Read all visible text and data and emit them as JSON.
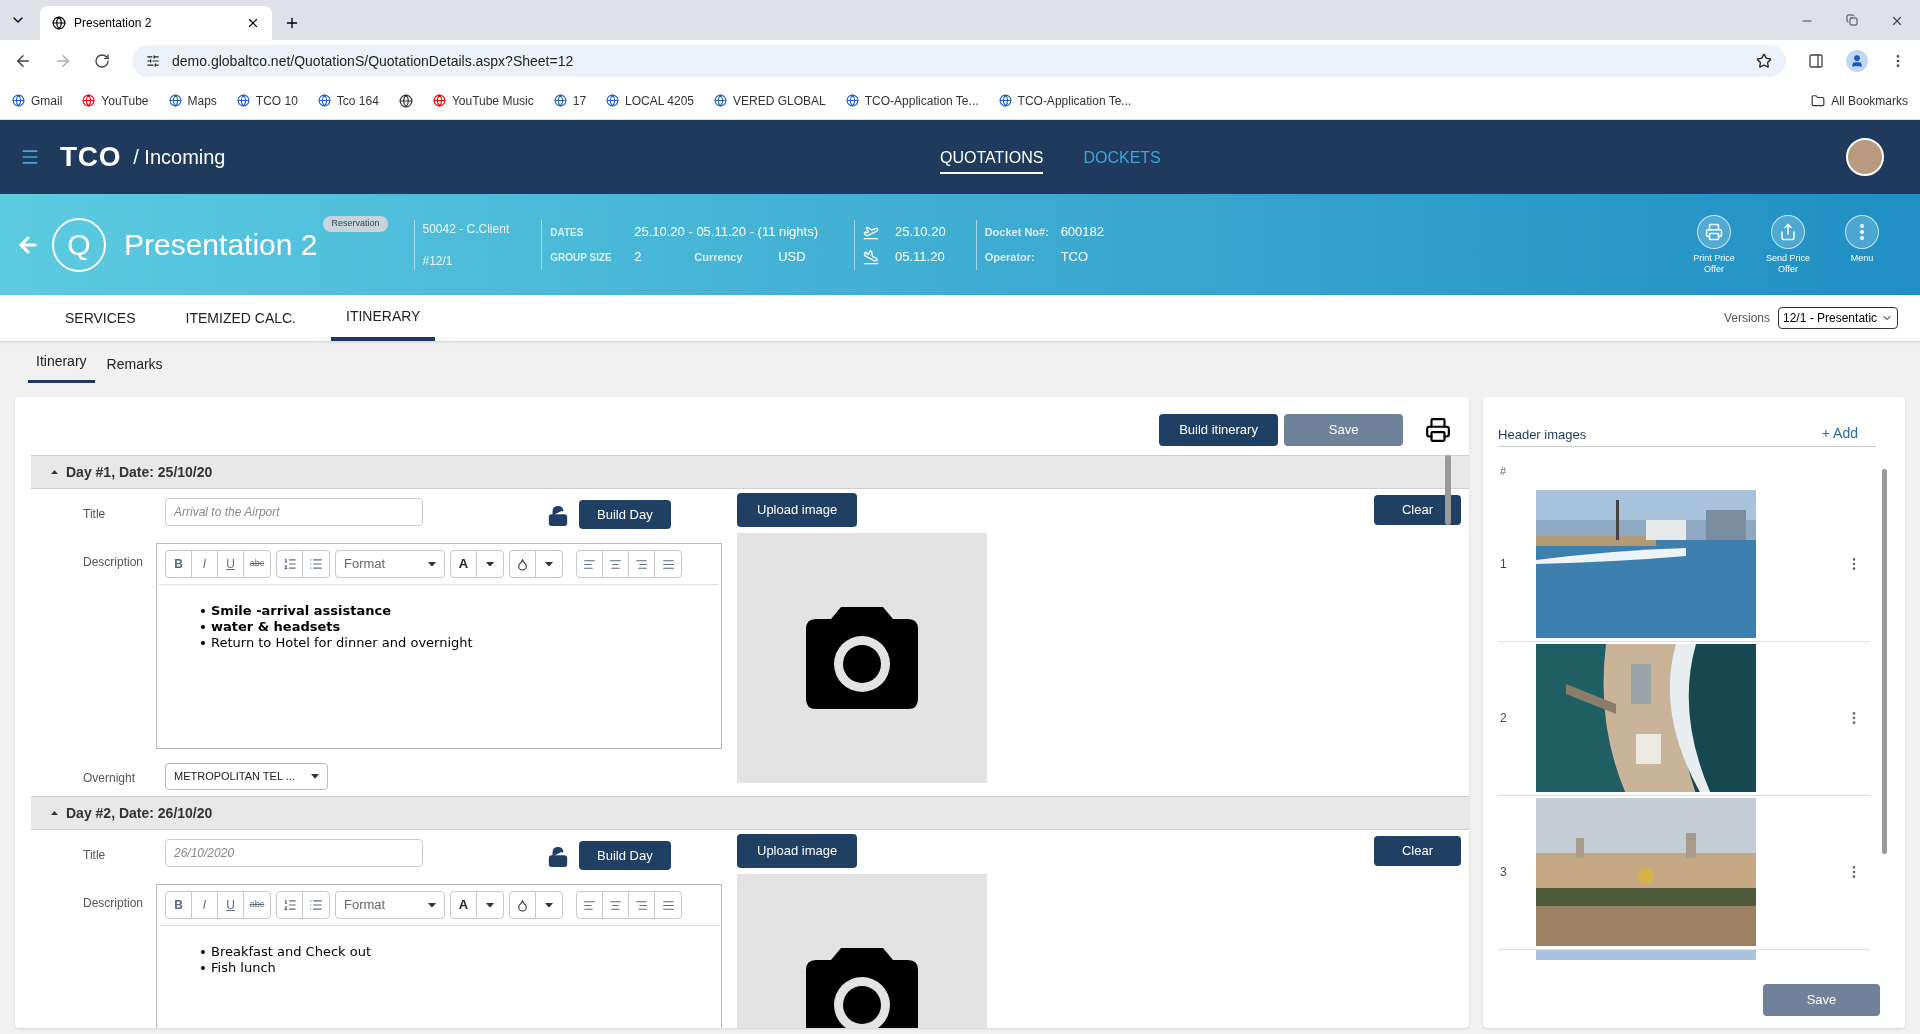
{
  "browser": {
    "tab_title": "Presentation 2",
    "url": "demo.globaltco.net/QuotationS/QuotationDetails.aspx?Sheet=12",
    "bookmarks": [
      {
        "kind": "link",
        "label": "Gmail"
      },
      {
        "kind": "link",
        "label": "YouTube"
      },
      {
        "kind": "link",
        "label": "Maps"
      },
      {
        "kind": "link",
        "label": "TCO 10"
      },
      {
        "kind": "link",
        "label": "Tco 164"
      },
      {
        "kind": "icon"
      },
      {
        "kind": "link",
        "label": "YouTube Music"
      },
      {
        "kind": "link",
        "label": "17"
      },
      {
        "kind": "link",
        "label": "LOCAL 4205"
      },
      {
        "kind": "link",
        "label": "VERED GLOBAL"
      },
      {
        "kind": "link",
        "label": "TCO-Application Te..."
      },
      {
        "kind": "link",
        "label": "TCO-Application Te..."
      }
    ],
    "all_bookmarks": "All Bookmarks"
  },
  "header": {
    "app_name": "TCO",
    "breadcrumb": "/ Incoming",
    "nav": [
      {
        "label": "QUOTATIONS",
        "selected": true
      },
      {
        "label": "DOCKETS",
        "selected": false
      }
    ]
  },
  "quote": {
    "badge": "Q",
    "title": "Presentation 2",
    "status": "Reservation",
    "client": "50042 - C.Client",
    "ref": "#12/1",
    "dates_label": "DATES",
    "dates": "25.10.20 - 05.11.20 - (11 nights)",
    "group_label": "GROUP SIZE",
    "group": "2",
    "currency_label": "Currency",
    "currency": "USD",
    "arrival": "25.10.20",
    "departure": "05.11.20",
    "docket_label": "Docket No#:",
    "docket": "600182",
    "operator_label": "Operator:",
    "operator": "TCO",
    "actions": [
      {
        "kind": "print",
        "label": "Print Price Offer"
      },
      {
        "kind": "send",
        "label": "Send Price Offer"
      },
      {
        "kind": "menu",
        "label": "Menu"
      }
    ]
  },
  "tabs": [
    {
      "label": "SERVICES",
      "selected": false
    },
    {
      "label": "ITEMIZED CALC.",
      "selected": false
    },
    {
      "label": "ITINERARY",
      "selected": true
    }
  ],
  "versions": {
    "label": "Versions",
    "value": "12/1 - Presentatic"
  },
  "subtabs": [
    {
      "label": "Itinerary",
      "selected": true
    },
    {
      "label": "Remarks",
      "selected": false
    }
  ],
  "toolbar": {
    "build": "Build itinerary",
    "save": "Save"
  },
  "days": [
    {
      "header": "Day #1, Date: 25/10/20",
      "expanded": true,
      "title_label": "Title",
      "title_placeholder": "Arrival to the Airport",
      "build_day": "Build Day",
      "upload": "Upload image",
      "clear": "Clear",
      "description_label": "Description",
      "editor": {
        "bold": "B",
        "italic": "I",
        "underline": "U",
        "strike": "abc",
        "format": "Format",
        "font_letter": "A"
      },
      "description": [
        {
          "text": "Smile -arrival assistance",
          "bold": true
        },
        {
          "text": "water & headsets",
          "bold": true
        },
        {
          "text": "Return to Hotel for dinner and overnight",
          "bold": false
        }
      ],
      "overnight_label": "Overnight",
      "overnight": "METROPOLITAN TEL ..."
    },
    {
      "header": "Day #2, Date: 26/10/20",
      "expanded": true,
      "title_label": "Title",
      "title_placeholder": "26/10/2020",
      "build_day": "Build Day",
      "upload": "Upload image",
      "clear": "Clear",
      "description_label": "Description",
      "editor": {
        "bold": "B",
        "italic": "I",
        "underline": "U",
        "strike": "abc",
        "format": "Format",
        "font_letter": "A"
      },
      "description": [
        {
          "text": "Breakfast and Check out",
          "bold": false
        },
        {
          "text": "Fish lunch",
          "bold": false
        }
      ]
    }
  ],
  "header_images": {
    "title": "Header images",
    "add": "+ Add",
    "hash": "#",
    "images": [
      {
        "number": "1",
        "kind": "picture",
        "partial": false
      },
      {
        "number": "2",
        "kind": "picture",
        "partial": false
      },
      {
        "number": "3",
        "kind": "picture",
        "partial": false
      },
      {
        "kind": "picture",
        "partial": true
      }
    ],
    "save": "Save"
  }
}
